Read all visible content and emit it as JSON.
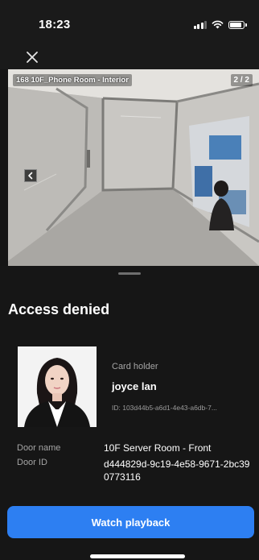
{
  "status_bar": {
    "time": "18:23",
    "icons": [
      "signal-icon",
      "wifi-icon",
      "battery-icon"
    ]
  },
  "nav": {
    "close_icon": "close-icon"
  },
  "camera": {
    "label": "168 10F_Phone Room - Interior",
    "counter": "2 / 2",
    "prev_icon": "chevron-left-icon"
  },
  "event": {
    "title": "Access denied",
    "card_holder_label": "Card holder",
    "card_holder_name": "joyce lan",
    "card_id": "ID: 103d44b5-a6d1-4e43-a6db-7...",
    "door_name_label": "Door name",
    "door_name": "10F Server Room - Front",
    "door_id_label": "Door ID",
    "door_id": "d444829d-9c19-4e58-9671-2bc390773116"
  },
  "actions": {
    "watch_playback": "Watch playback"
  },
  "colors": {
    "background": "#151515",
    "accent": "#2d7ff2",
    "muted_text": "#a5a5a5"
  }
}
